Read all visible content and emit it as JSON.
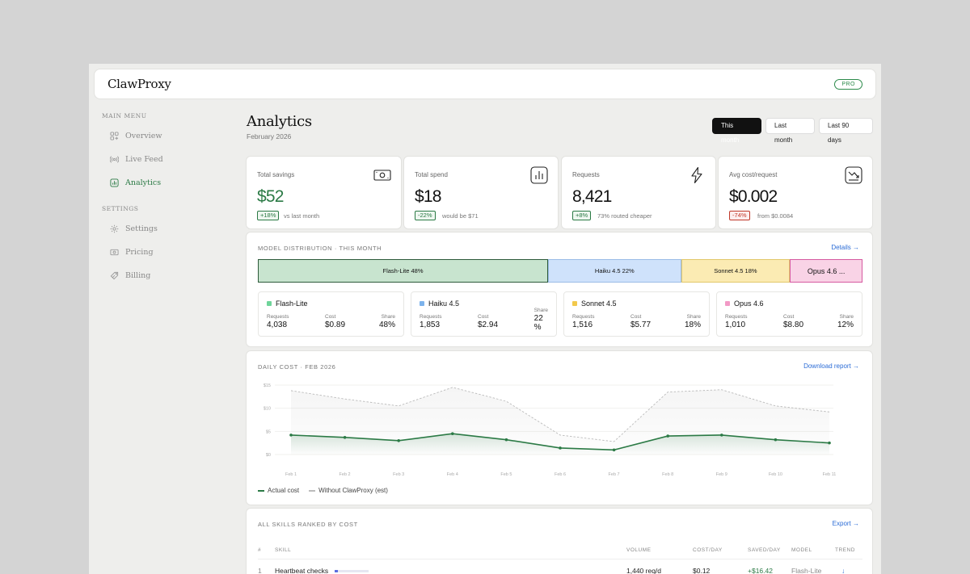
{
  "app": {
    "brand": "ClawProxy",
    "plan_badge": "PRO"
  },
  "sidebar": {
    "main_heading": "MAIN MENU",
    "settings_heading": "SETTINGS",
    "items": [
      {
        "label": "Overview",
        "icon": "grid-icon"
      },
      {
        "label": "Live Feed",
        "icon": "broadcast-icon"
      },
      {
        "label": "Analytics",
        "icon": "bar-chart-icon",
        "active": true
      },
      {
        "label": "Settings",
        "icon": "gear-icon"
      },
      {
        "label": "Pricing",
        "icon": "cash-icon"
      },
      {
        "label": "Billing",
        "icon": "tag-icon"
      }
    ]
  },
  "header": {
    "title": "Analytics",
    "subtitle": "February 2026",
    "ranges": [
      "This month",
      "Last month",
      "Last 90 days"
    ],
    "selected_range": "This month"
  },
  "stats": [
    {
      "label": "Total savings",
      "value": "$52",
      "badge": "+18%",
      "note": "vs last month",
      "icon": "banknote-icon"
    },
    {
      "label": "Total spend",
      "value": "$18",
      "badge": "-22%",
      "note": "would be $71",
      "icon": "bar-chart-icon"
    },
    {
      "label": "Requests",
      "value": "8,421",
      "badge": "+8%",
      "note": "73% routed cheaper",
      "icon": "lightning-icon"
    },
    {
      "label": "Avg cost/request",
      "value": "$0.002",
      "badge": "-74%",
      "note": "from $0.0084",
      "icon": "trend-down-icon"
    }
  ],
  "distribution": {
    "title": "MODEL DISTRIBUTION · THIS MONTH",
    "details_link": "Details →",
    "segments": [
      {
        "label": "Flash-Lite 48%",
        "share": 48,
        "color": "#c8e4cf",
        "border": "#2d5a3a"
      },
      {
        "label": "Haiku 4.5 22%",
        "share": 22,
        "color": "#cfe2fb",
        "border": "#9bbce6"
      },
      {
        "label": "Sonnet 4.5 18%",
        "share": 18,
        "color": "#fbebb3",
        "border": "#e2c76a"
      },
      {
        "label": "Opus 4.6 ...",
        "share": 12,
        "color": "#f9d3e6",
        "border": "#d65aa0"
      }
    ],
    "labels": {
      "requests": "Requests",
      "cost": "Cost",
      "share": "Share"
    },
    "models": [
      {
        "name": "Flash-Lite",
        "color": "#6fd49a",
        "requests": "4,038",
        "cost": "$0.89",
        "share": "48%"
      },
      {
        "name": "Haiku 4.5",
        "color": "#7db3ec",
        "requests": "1,853",
        "cost": "$2.94",
        "share": "22 %"
      },
      {
        "name": "Sonnet 4.5",
        "color": "#f2c94c",
        "requests": "1,516",
        "cost": "$5.77",
        "share": "18%"
      },
      {
        "name": "Opus 4.6",
        "color": "#f29ac6",
        "requests": "1,010",
        "cost": "$8.80",
        "share": "12%"
      }
    ]
  },
  "daily": {
    "title": "DAILY COST · FEB 2026",
    "download_link": "Download report →",
    "legend_actual": "Actual cost",
    "legend_without": "Without ClawProxy (est)"
  },
  "chart_data": {
    "type": "line",
    "x": [
      "Feb 1",
      "Feb 2",
      "Feb 3",
      "Feb 4",
      "Feb 5",
      "Feb 6",
      "Feb 7",
      "Feb 8",
      "Feb 9",
      "Feb 10",
      "Feb 11"
    ],
    "y_ticks": [
      "$15",
      "$10",
      "$5",
      "$0"
    ],
    "y_tick_values": [
      15,
      10,
      5,
      0
    ],
    "ylim": [
      0,
      15
    ],
    "series": [
      {
        "name": "Actual cost",
        "color": "#2b7a45",
        "values": [
          4.2,
          3.7,
          3.0,
          4.5,
          3.2,
          1.4,
          1.0,
          4.0,
          4.2,
          3.2,
          2.5
        ]
      },
      {
        "name": "Without ClawProxy (est)",
        "color": "#bbbbbb",
        "values": [
          13.8,
          12.0,
          10.5,
          14.5,
          11.5,
          4.2,
          2.8,
          13.5,
          14.0,
          10.5,
          9.2
        ]
      }
    ]
  },
  "skills": {
    "title": "ALL SKILLS RANKED BY COST",
    "export_link": "Export →",
    "columns": [
      "#",
      "SKILL",
      "VOLUME",
      "COST/DAY",
      "SAVED/DAY",
      "MODEL",
      "TREND"
    ],
    "rows": [
      {
        "rank": "1",
        "skill": "Heartbeat checks",
        "volume": "1,440 req/d",
        "cost": "$0.12",
        "saved": "+$16.42",
        "model": "Flash-Lite",
        "trend": "↓"
      }
    ]
  }
}
